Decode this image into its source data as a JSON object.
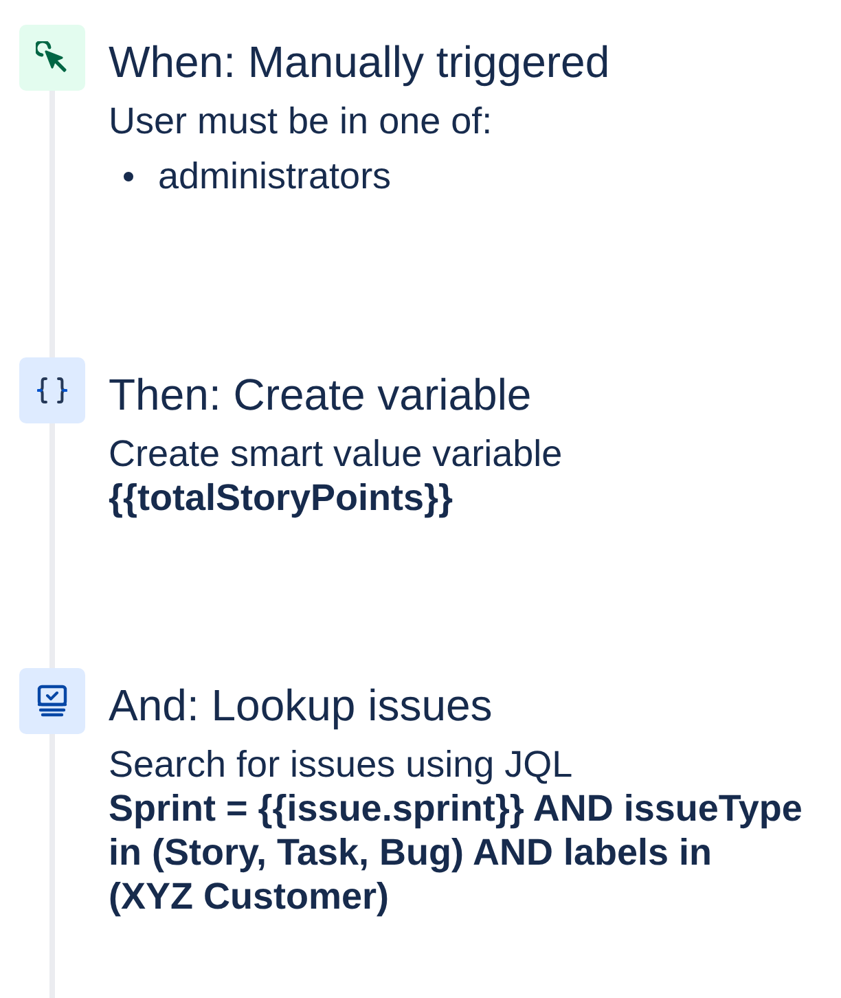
{
  "steps": [
    {
      "kind": "trigger",
      "title": "When: Manually triggered",
      "description": "User must be in one of:",
      "list": [
        "administrators"
      ]
    },
    {
      "kind": "variable",
      "title": "Then: Create variable",
      "description": "Create smart value variable",
      "detail": "{{totalStoryPoints}}"
    },
    {
      "kind": "lookup",
      "title": "And: Lookup issues",
      "description": "Search for issues using JQL",
      "detail": "Sprint = {{issue.sprint}} AND issueType in (Story, Task, Bug) AND labels in (XYZ Customer)"
    }
  ]
}
